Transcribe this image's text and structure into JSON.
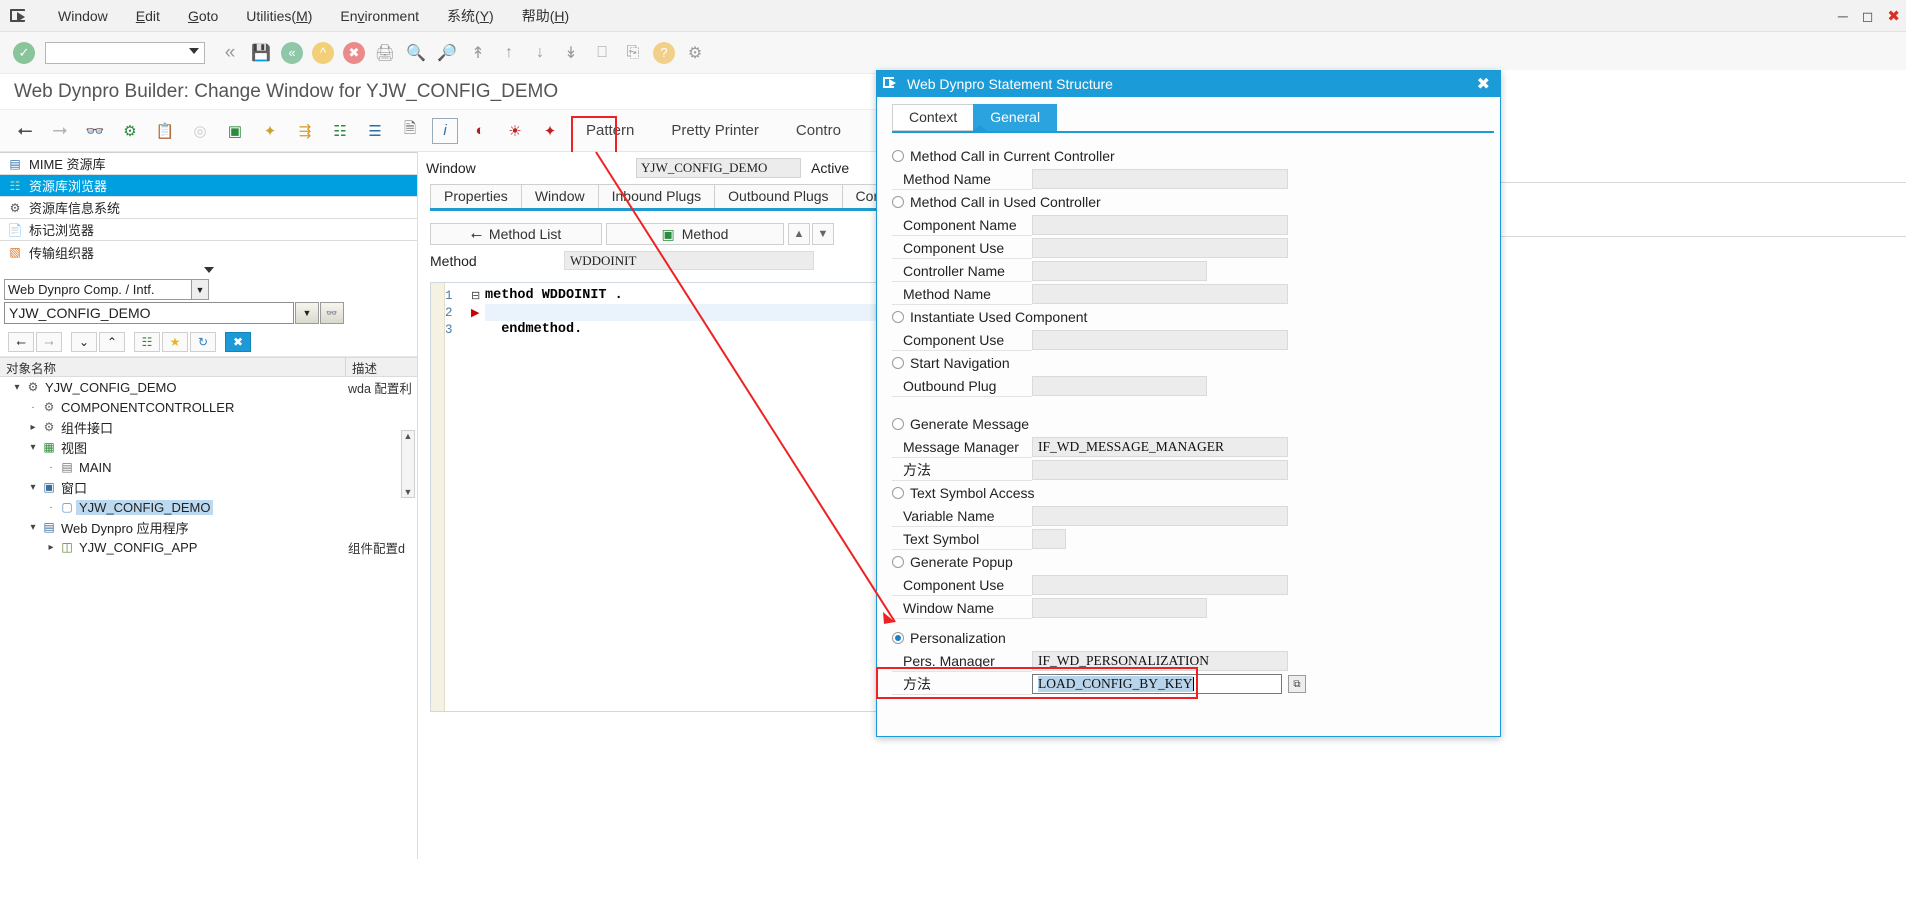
{
  "menu": {
    "logo_icon": "sap-window-icon",
    "items": [
      {
        "label": "Window",
        "accel": ""
      },
      {
        "label": "Edit",
        "accel": "E"
      },
      {
        "label": "Goto",
        "accel": "G"
      },
      {
        "label": "Utilities(M)",
        "accel": "M"
      },
      {
        "label": "Environment",
        "accel": "v"
      },
      {
        "label": "系统(Y)",
        "accel": "Y"
      },
      {
        "label": "帮助(H)",
        "accel": "H"
      }
    ],
    "window_controls": {
      "minimize": "—",
      "maximize": "▣",
      "close": "✕"
    }
  },
  "sap_toolbar": {
    "enter_icon": "green-check-icon",
    "command_field_value": "",
    "buttons": [
      "back-icon",
      "save-icon",
      "back-green-icon",
      "up-yellow-icon",
      "cancel-red-icon",
      "print-icon",
      "find-icon",
      "find-next-icon",
      "first-page-icon",
      "previous-page-icon",
      "next-page-icon",
      "last-page-icon",
      "create-session-icon",
      "create-shortcut-icon",
      "help-icon",
      "customize-icon"
    ]
  },
  "page_title": "Web Dynpro Builder: Change Window for YJW_CONFIG_DEMO",
  "app_toolbar": {
    "icons": [
      "back-arrow-icon",
      "forward-arrow-icon",
      "display-change-icon",
      "activate-icon",
      "paste-icon",
      "check-icon",
      "insert-statement-icon",
      "pattern-wizard-icon",
      "web-dynpro-code-icon",
      "hierarchy-icon",
      "sort-icon",
      "documentation-icon",
      "info-icon",
      "coverage-icon",
      "where-used-icon",
      "wd-statement-wizard-icon"
    ],
    "labels": [
      "Pattern",
      "Pretty Printer",
      "Contro"
    ],
    "highlighted_icon": "wd-statement-wizard-icon"
  },
  "left_panel": {
    "repository_items": [
      {
        "label": "MIME 资源库",
        "icon": "mime-repository-icon",
        "selected": false
      },
      {
        "label": "资源库浏览器",
        "icon": "repository-browser-icon",
        "selected": true
      },
      {
        "label": "资源库信息系统",
        "icon": "repository-infosystem-icon",
        "selected": false
      },
      {
        "label": "标记浏览器",
        "icon": "tag-browser-icon",
        "selected": false
      },
      {
        "label": "传输组织器",
        "icon": "transport-organizer-icon",
        "selected": false
      }
    ],
    "object_type_select": {
      "value": "Web Dynpro Comp. / Intf.",
      "icon": "chevron-down-icon"
    },
    "object_name": {
      "value": "YJW_CONFIG_DEMO",
      "dropdown_icon": "triangle-down-icon",
      "display_icon": "glasses-icon"
    },
    "tree_toolbar": [
      "back-icon",
      "forward-icon",
      "expand-all-icon",
      "collapse-all-icon",
      "hierarchy-icon",
      "favorites-star-icon",
      "refresh-icon",
      "close-x-icon"
    ],
    "tree_headers": [
      "对象名称",
      "描述"
    ],
    "tree": [
      {
        "label": "YJW_CONFIG_DEMO",
        "desc": "wda 配置利",
        "indent": 0,
        "twist": "v",
        "icon": "component-icon",
        "selected": false
      },
      {
        "label": "COMPONENTCONTROLLER",
        "desc": "",
        "indent": 1,
        "twist": "dot",
        "icon": "controller-icon",
        "selected": false
      },
      {
        "label": "组件接口",
        "desc": "",
        "indent": 1,
        "twist": ">",
        "icon": "component-icon",
        "selected": false
      },
      {
        "label": "视图",
        "desc": "",
        "indent": 1,
        "twist": "v",
        "icon": "views-folder-icon",
        "selected": false
      },
      {
        "label": "MAIN",
        "desc": "",
        "indent": 2,
        "twist": "dot",
        "icon": "view-icon",
        "selected": false
      },
      {
        "label": "窗口",
        "desc": "",
        "indent": 1,
        "twist": "v",
        "icon": "windows-folder-icon",
        "selected": false
      },
      {
        "label": "YJW_CONFIG_DEMO",
        "desc": "",
        "indent": 2,
        "twist": "dot",
        "icon": "window-icon",
        "selected": true
      },
      {
        "label": "Web Dynpro 应用程序",
        "desc": "",
        "indent": 1,
        "twist": "v",
        "icon": "applications-folder-icon",
        "selected": false
      },
      {
        "label": "YJW_CONFIG_APP",
        "desc": "组件配置d",
        "indent": 2,
        "twist": ">",
        "icon": "application-icon",
        "selected": false
      }
    ]
  },
  "center_panel": {
    "window_label": "Window",
    "window_value": "YJW_CONFIG_DEMO",
    "status": "Active",
    "tabs": [
      "Properties",
      "Window",
      "Inbound Plugs",
      "Outbound Plugs",
      "Context"
    ],
    "active_tab": "Properties",
    "method_list_button": "Method List",
    "method_button": "Method",
    "up_icon": "triangle-up-icon",
    "down_icon": "triangle-down-icon",
    "method_label": "Method",
    "method_value": "WDDOINIT",
    "code_lines": [
      {
        "num": "1",
        "text": "method WDDOINIT .",
        "fold": "⊟",
        "mark": "",
        "highlight": false
      },
      {
        "num": "2",
        "text": "",
        "fold": "",
        "mark": "▶",
        "highlight": true
      },
      {
        "num": "3",
        "text": "  endmethod.",
        "fold": "",
        "mark": "",
        "highlight": false
      }
    ]
  },
  "dialog": {
    "title": "Web Dynpro Statement Structure",
    "title_icon": "sap-window-icon",
    "close_icon": "close-icon",
    "tabs": [
      {
        "label": "Context",
        "active": false
      },
      {
        "label": "General",
        "active": true
      }
    ],
    "options": [
      {
        "label": "Method Call in Current Controller",
        "selected": false,
        "fields": [
          {
            "label": "Method Name",
            "value": "",
            "width": "long"
          }
        ]
      },
      {
        "label": "Method Call in Used Controller",
        "selected": false,
        "fields": [
          {
            "label": "Component Name",
            "value": "",
            "width": "long"
          },
          {
            "label": "Component Use",
            "value": "",
            "width": "long"
          },
          {
            "label": "Controller Name",
            "value": "",
            "width": "med"
          },
          {
            "label": "Method Name",
            "value": "",
            "width": "long"
          }
        ]
      },
      {
        "label": "Instantiate Used Component",
        "selected": false,
        "fields": [
          {
            "label": "Component Use",
            "value": "",
            "width": "long"
          }
        ]
      },
      {
        "label": "Start Navigation",
        "selected": false,
        "fields": [
          {
            "label": "Outbound Plug",
            "value": "",
            "width": "med"
          }
        ]
      },
      {
        "label": "Generate Message",
        "selected": false,
        "fields": [
          {
            "label": "Message Manager",
            "value": "IF_WD_MESSAGE_MANAGER",
            "width": "long"
          },
          {
            "label": "方法",
            "value": "",
            "width": "long"
          }
        ]
      },
      {
        "label": "Text Symbol Access",
        "selected": false,
        "fields": [
          {
            "label": "Variable Name",
            "value": "",
            "width": "long"
          },
          {
            "label": "Text Symbol",
            "value": "",
            "width": "short"
          }
        ]
      },
      {
        "label": "Generate Popup",
        "selected": false,
        "fields": [
          {
            "label": "Component Use",
            "value": "",
            "width": "long"
          },
          {
            "label": "Window Name",
            "value": "",
            "width": "med"
          }
        ]
      },
      {
        "label": "Personalization",
        "selected": true,
        "fields": [
          {
            "label": "Pers. Manager",
            "value": "IF_WD_PERSONALIZATION",
            "width": "long"
          },
          {
            "label": "方法",
            "value": "LOAD_CONFIG_BY_KEY",
            "width": "focused",
            "focused": true,
            "copy_icon": "copy-icon"
          }
        ]
      }
    ]
  }
}
